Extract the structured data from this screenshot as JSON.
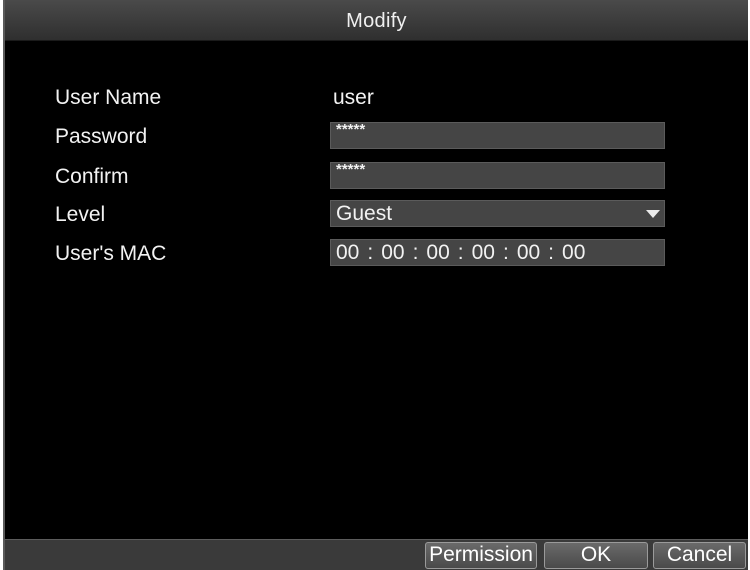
{
  "dialog": {
    "title": "Modify"
  },
  "form": {
    "user_name": {
      "label": "User Name",
      "value": "user"
    },
    "password": {
      "label": "Password",
      "value": "*****"
    },
    "confirm": {
      "label": "Confirm",
      "value": "*****"
    },
    "level": {
      "label": "Level",
      "value": "Guest"
    },
    "mac": {
      "label": "User's MAC",
      "octets": [
        "00",
        "00",
        "00",
        "00",
        "00",
        "00"
      ],
      "separator": ":"
    }
  },
  "buttons": {
    "permission": "Permission",
    "ok": "OK",
    "cancel": "Cancel"
  },
  "icons": {
    "level_dropdown": "chevron-down-icon"
  }
}
